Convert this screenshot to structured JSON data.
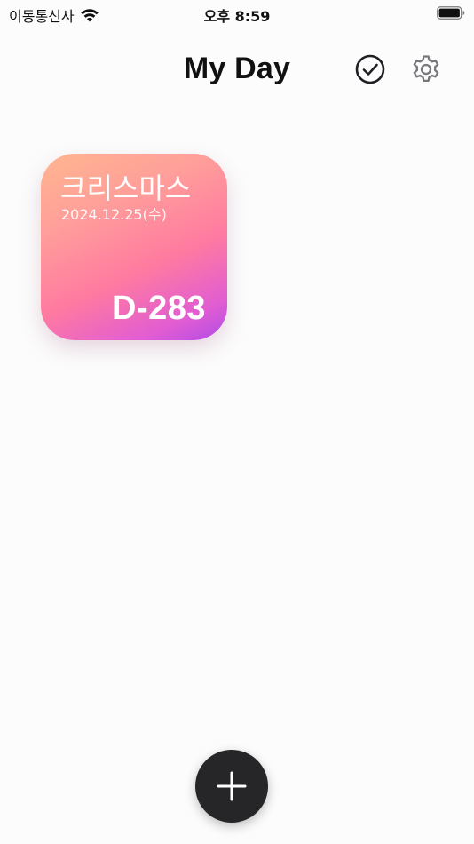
{
  "status_bar": {
    "carrier": "이동통신사",
    "time": "오후 8:59",
    "icons": [
      "wifi-icon",
      "battery-icon"
    ]
  },
  "header": {
    "title": "My Day",
    "actions": [
      {
        "name": "completed",
        "icon": "check-circle-icon"
      },
      {
        "name": "settings",
        "icon": "gear-icon"
      }
    ]
  },
  "events": [
    {
      "title": "크리스마스",
      "date": "2024.12.25(수)",
      "dday": "D-283",
      "gradient": [
        "#ffb68f",
        "#ff7aa0",
        "#b04be8"
      ]
    }
  ],
  "fab": {
    "icon": "plus-icon",
    "color": "#262628"
  }
}
